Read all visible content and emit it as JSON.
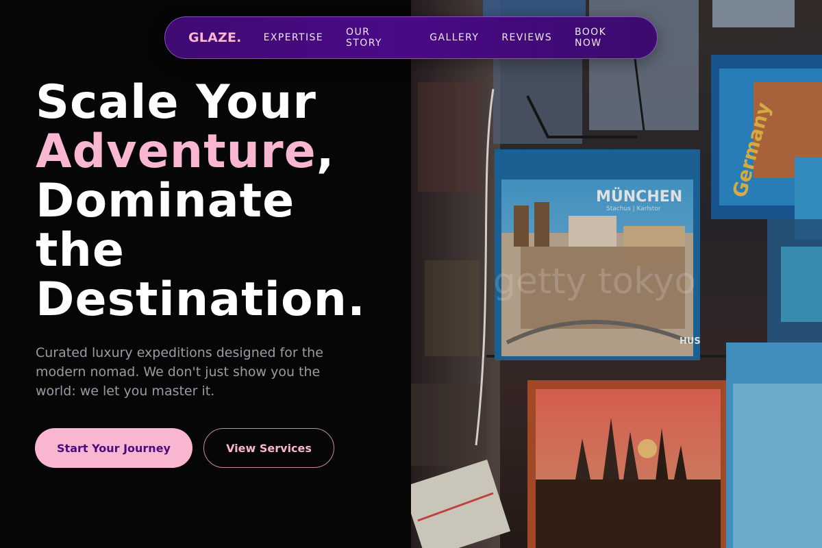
{
  "brand": {
    "logo": "GLAZE.",
    "accent_color": "#f9b6d0",
    "nav_color": "#4b0a86"
  },
  "nav": {
    "links": [
      "EXPERTISE",
      "OUR STORY",
      "GALLERY",
      "REVIEWS",
      "BOOK NOW"
    ]
  },
  "hero": {
    "title_line1": "Scale Your",
    "title_accent": "Adventure",
    "title_comma": ",",
    "title_line3": "Dominate",
    "title_line4": "the",
    "title_line5": "Destination.",
    "subtitle": "Curated luxury expeditions designed for the modern nomad. We don't just show you the world: we let you master it.",
    "primary_cta": "Start Your Journey",
    "secondary_cta": "View Services"
  },
  "photo": {
    "postcard_main_text": "MÜNCHEN",
    "postcard_main_subtext": "Stachus | Karlstor",
    "postcard_side_text": "Germany",
    "postcard_corner_text": "HUS",
    "watermark": "getty tokyo"
  }
}
